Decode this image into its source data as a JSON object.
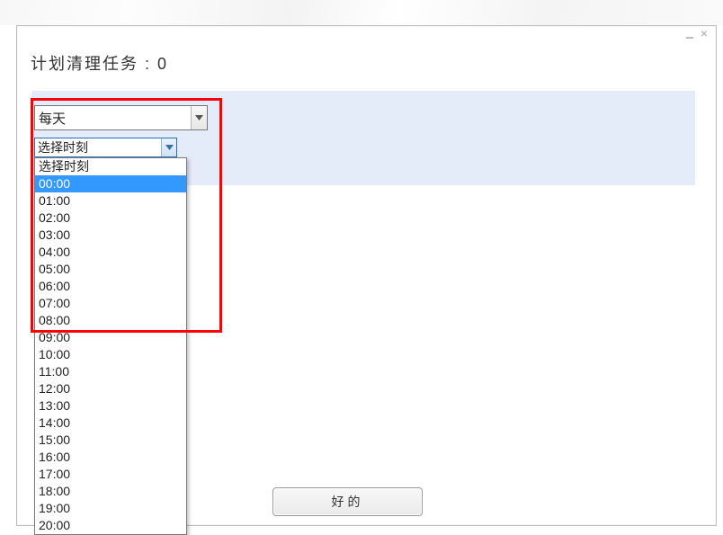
{
  "title": "计划清理任务 : 0",
  "select1": {
    "value": "每天"
  },
  "select2": {
    "value": "选择时刻",
    "options_header": "选择时刻",
    "highlight_index": 1,
    "options": [
      "选择时刻",
      "00:00",
      "01:00",
      "02:00",
      "03:00",
      "04:00",
      "05:00",
      "06:00",
      "07:00",
      "08:00",
      "09:00",
      "10:00",
      "11:00",
      "12:00",
      "13:00",
      "14:00",
      "15:00",
      "16:00",
      "17:00",
      "18:00",
      "19:00",
      "20:00"
    ]
  },
  "ok_label": "好的",
  "window": {
    "minimize": "minimize",
    "close": "close"
  }
}
